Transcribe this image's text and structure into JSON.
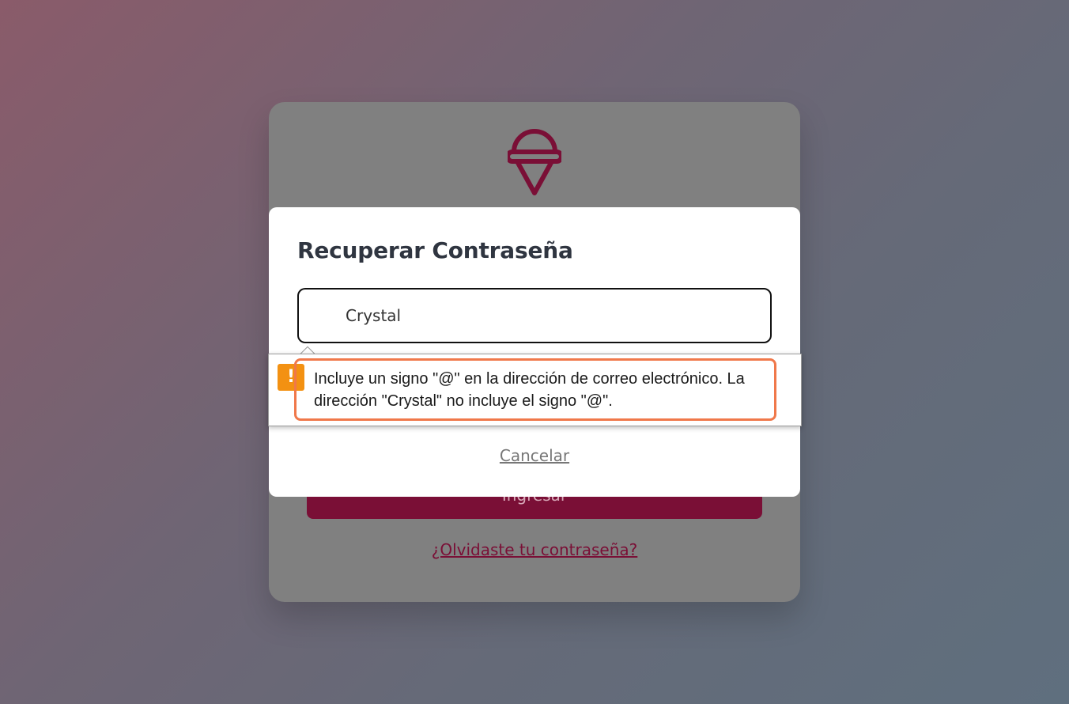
{
  "login_card": {
    "logo_icon": "ice-cream-cone-icon",
    "brand_color": "#7a0f36",
    "submit_button_label": "Ingresar",
    "forgot_password_link": "¿Olvidaste tu contraseña?"
  },
  "recover_modal": {
    "title": "Recuperar Contraseña",
    "email_input": {
      "value": "Crystal",
      "type": "email"
    },
    "cancel_label": "Cancelar"
  },
  "validation_tooltip": {
    "icon": "warning-exclamation-icon",
    "icon_color": "#f39112",
    "message": "Incluye un signo \"@\" en la dirección de correo electrónico. La dirección \"Crystal\" no incluye el signo \"@\".",
    "highlight_color": "#f0784a"
  }
}
